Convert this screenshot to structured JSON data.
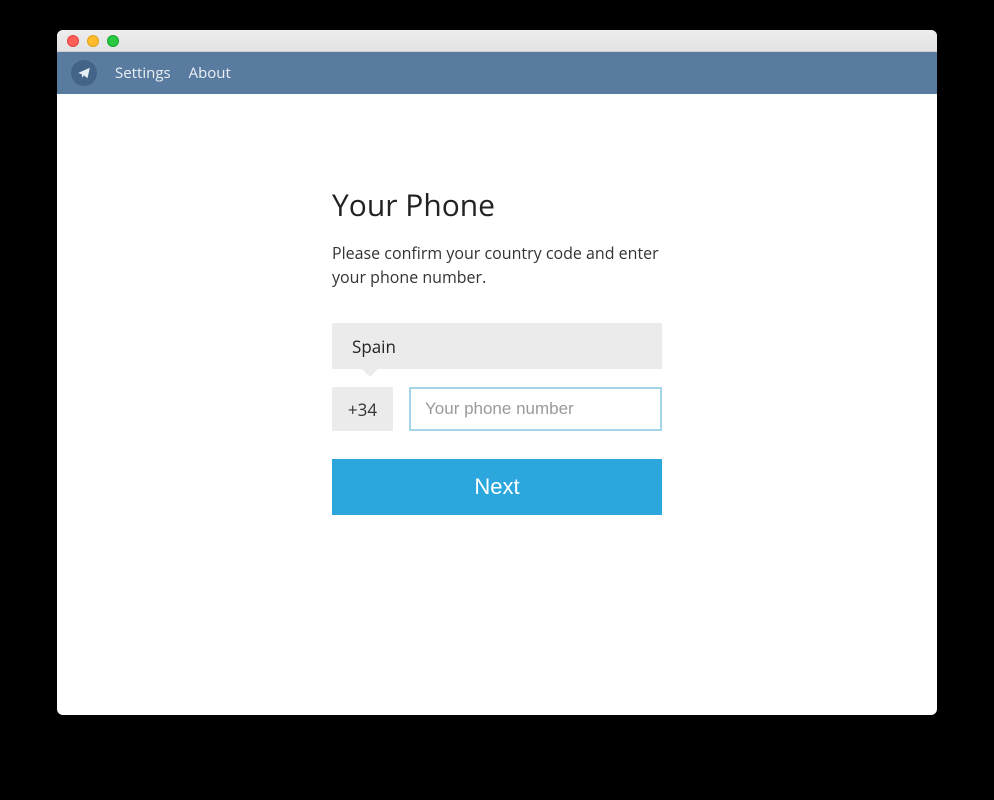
{
  "menubar": {
    "settings": "Settings",
    "about": "About"
  },
  "form": {
    "heading": "Your Phone",
    "subtitle": "Please confirm your country code and enter your phone number.",
    "country": "Spain",
    "country_code": "+34",
    "phone_placeholder": "Your phone number",
    "phone_value": "",
    "next_label": "Next"
  }
}
